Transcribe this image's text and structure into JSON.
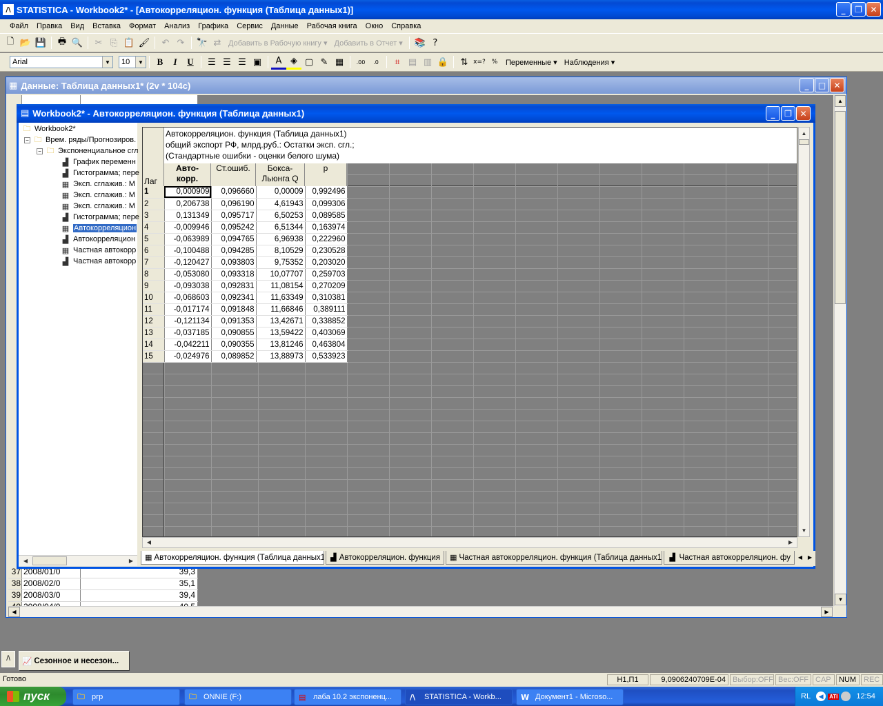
{
  "app": {
    "title": "STATISTICA - Workbook2* - [Автокорреляцион. функция (Таблица данных1)]",
    "icon": "statistica-icon"
  },
  "menu": [
    "Файл",
    "Правка",
    "Вид",
    "Вставка",
    "Формат",
    "Анализ",
    "Графика",
    "Сервис",
    "Данные",
    "Рабочая книга",
    "Окно",
    "Справка"
  ],
  "toolbar1": {
    "add_workbook": "Добавить в Рабочую книгу",
    "add_report": "Добавить в Отчет"
  },
  "toolbar2": {
    "font": "Arial",
    "size": "10",
    "bold": "B",
    "italic": "I",
    "underline": "U",
    "variables": "Переменные",
    "observations": "Наблюдения"
  },
  "data_window": {
    "title": "Данные: Таблица данных1* (2v * 104c)",
    "rows": [
      {
        "n": "37",
        "date": "2008/01/0",
        "val": "39,3"
      },
      {
        "n": "38",
        "date": "2008/02/0",
        "val": "35,1"
      },
      {
        "n": "39",
        "date": "2008/03/0",
        "val": "39,4"
      },
      {
        "n": "40",
        "date": "2008/04/0",
        "val": "40,5"
      }
    ]
  },
  "workbook": {
    "title": "Workbook2* - Автокорреляцион. функция (Таблица данных1)",
    "tree": [
      {
        "label": "Workbook2*",
        "level": 0,
        "icon": "folder-icon"
      },
      {
        "label": "Врем. ряды/Прогнозиров.",
        "level": 1,
        "icon": "folder-icon"
      },
      {
        "label": "Экспоненциальное сгл",
        "level": 2,
        "icon": "folder-icon"
      },
      {
        "label": "График переменн",
        "level": 3,
        "icon": "graph-doc-icon"
      },
      {
        "label": "Гистограмма; пере",
        "level": 3,
        "icon": "graph-doc-icon"
      },
      {
        "label": "Эксп. сглажив.: М",
        "level": 3,
        "icon": "sheet-icon"
      },
      {
        "label": "Эксп. сглажив.: М",
        "level": 3,
        "icon": "sheet-icon"
      },
      {
        "label": "Эксп. сглажив.: М",
        "level": 3,
        "icon": "sheet-icon"
      },
      {
        "label": "Гистограмма; пере",
        "level": 3,
        "icon": "graph-doc-icon"
      },
      {
        "label": "Автокорреляцион",
        "level": 3,
        "icon": "sheet-icon",
        "selected": true
      },
      {
        "label": "Автокорреляцион",
        "level": 3,
        "icon": "graph-doc-icon"
      },
      {
        "label": "Частная автокорр",
        "level": 3,
        "icon": "sheet-icon"
      },
      {
        "label": "Частная автокорр",
        "level": 3,
        "icon": "graph-doc-icon"
      }
    ],
    "sheet_header": [
      "Автокорреляцион. функция (Таблица данных1)",
      "общий экспорт РФ, млрд.руб.: Остатки эксп. сгл.;",
      "(Стандартные ошибки - оценки белого шума)"
    ],
    "row_header_label": "Лаг",
    "columns": [
      {
        "line1": "Авто-",
        "line2": "корр."
      },
      {
        "line1": "Ст.ошиб.",
        "line2": ""
      },
      {
        "line1": "Бокса-",
        "line2": "Льюнга Q"
      },
      {
        "line1": "p",
        "line2": ""
      }
    ],
    "rows": [
      {
        "lag": "1",
        "ac": "0,000909",
        "se": "0,096660",
        "q": "0,00009",
        "p": "0,992496"
      },
      {
        "lag": "2",
        "ac": "0,206738",
        "se": "0,096190",
        "q": "4,61943",
        "p": "0,099306"
      },
      {
        "lag": "3",
        "ac": "0,131349",
        "se": "0,095717",
        "q": "6,50253",
        "p": "0,089585"
      },
      {
        "lag": "4",
        "ac": "-0,009946",
        "se": "0,095242",
        "q": "6,51344",
        "p": "0,163974"
      },
      {
        "lag": "5",
        "ac": "-0,063989",
        "se": "0,094765",
        "q": "6,96938",
        "p": "0,222960"
      },
      {
        "lag": "6",
        "ac": "-0,100488",
        "se": "0,094285",
        "q": "8,10529",
        "p": "0,230528"
      },
      {
        "lag": "7",
        "ac": "-0,120427",
        "se": "0,093803",
        "q": "9,75352",
        "p": "0,203020"
      },
      {
        "lag": "8",
        "ac": "-0,053080",
        "se": "0,093318",
        "q": "10,07707",
        "p": "0,259703"
      },
      {
        "lag": "9",
        "ac": "-0,093038",
        "se": "0,092831",
        "q": "11,08154",
        "p": "0,270209"
      },
      {
        "lag": "10",
        "ac": "-0,068603",
        "se": "0,092341",
        "q": "11,63349",
        "p": "0,310381"
      },
      {
        "lag": "11",
        "ac": "-0,017174",
        "se": "0,091848",
        "q": "11,66846",
        "p": "0,389111"
      },
      {
        "lag": "12",
        "ac": "-0,121134",
        "se": "0,091353",
        "q": "13,42671",
        "p": "0,338852"
      },
      {
        "lag": "13",
        "ac": "-0,037185",
        "se": "0,090855",
        "q": "13,59422",
        "p": "0,403069"
      },
      {
        "lag": "14",
        "ac": "-0,042211",
        "se": "0,090355",
        "q": "13,81246",
        "p": "0,463804"
      },
      {
        "lag": "15",
        "ac": "-0,024976",
        "se": "0,089852",
        "q": "13,88973",
        "p": "0,533923"
      }
    ],
    "tabs": [
      "Автокорреляцион. функция (Таблица данных1)",
      "Автокорреляцион. функция",
      "Частная автокорреляцион. функция (Таблица данных1)",
      "Частная автокорреляцион. фу"
    ]
  },
  "minimized": {
    "label": "Сезонное и несезон..."
  },
  "status": {
    "ready": "Готово",
    "cell": "Н1,П1",
    "value": "9,0906240709E-04",
    "sel": "Выбор:OFF",
    "weight": "Вес:OFF",
    "cap": "CAP",
    "num": "NUM",
    "rec": "REC"
  },
  "taskbar": {
    "start": "пуск",
    "items": [
      {
        "label": "ргр",
        "icon": "folder-icon"
      },
      {
        "label": "ONNIE (F:)",
        "icon": "folder-icon"
      },
      {
        "label": "лаба 10.2 экспоненц...",
        "icon": "pdf-icon"
      },
      {
        "label": "STATISTICA - Workb...",
        "icon": "statistica-icon",
        "active": true
      },
      {
        "label": "Документ1 - Microso...",
        "icon": "word-icon"
      }
    ],
    "lang": "RL",
    "clock": "12:54"
  },
  "colors": {
    "xp_blue": "#0058ee",
    "face": "#ece9d8",
    "selected": "#316ac5",
    "dark_gray": "#808080"
  }
}
